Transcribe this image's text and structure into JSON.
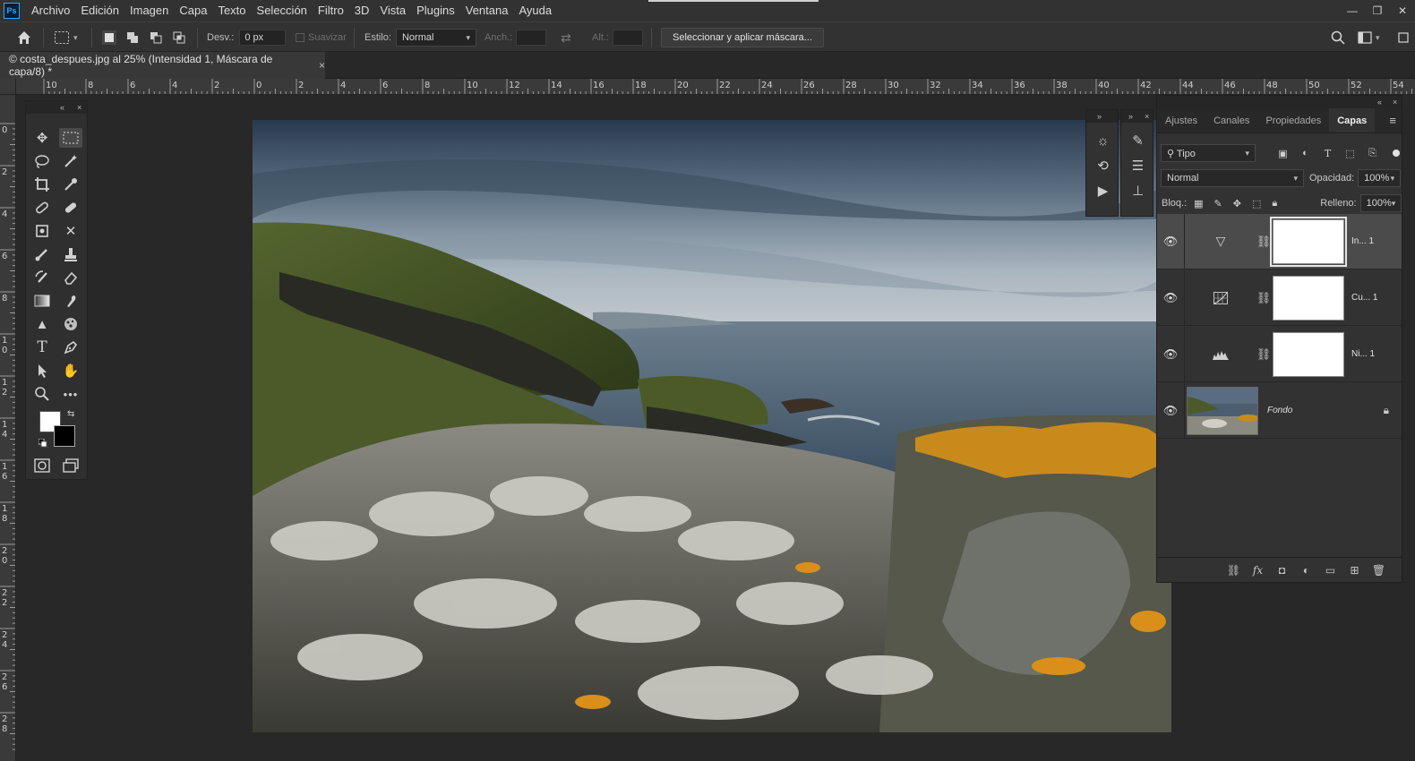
{
  "app": {
    "logo_text": "Ps"
  },
  "menu": [
    "Archivo",
    "Edición",
    "Imagen",
    "Capa",
    "Texto",
    "Selección",
    "Filtro",
    "3D",
    "Vista",
    "Plugins",
    "Ventana",
    "Ayuda"
  ],
  "window_controls": {
    "minimize": "—",
    "restore": "❐",
    "close": "✕"
  },
  "options": {
    "feather_label": "Desv.:",
    "feather_value": "0 px",
    "antialias_label": "Suavizar",
    "style_label": "Estilo:",
    "style_value": "Normal",
    "width_label": "Anch.:",
    "height_label": "Alt.:",
    "select_mask_button": "Seleccionar y aplicar máscara..."
  },
  "document": {
    "tab_title": "© costa_despues.jpg al 25% (Intensidad 1, Máscara de capa/8) *",
    "close": "×"
  },
  "rulers": {
    "horizontal": [
      "10",
      "8",
      "6",
      "4",
      "2",
      "0",
      "2",
      "4",
      "6",
      "8",
      "10",
      "12",
      "14",
      "16",
      "18",
      "20",
      "22",
      "24",
      "26",
      "28",
      "30",
      "32",
      "34",
      "36",
      "38",
      "40",
      "42",
      "44",
      "46",
      "48",
      "50",
      "52",
      "54"
    ],
    "vertical": [
      "0",
      "2",
      "4",
      "6",
      "8",
      "10",
      "12",
      "14",
      "16",
      "18",
      "20",
      "22",
      "24",
      "26",
      "28"
    ]
  },
  "toolbox": {
    "collapse": "«",
    "close": "×",
    "colors": {
      "foreground": "#ffffff",
      "background": "#000000"
    }
  },
  "mini_panel": {
    "collapse": "»",
    "close": "×"
  },
  "layers_panel": {
    "collapse": "«",
    "close": "×",
    "tabs": [
      "Ajustes",
      "Canales",
      "Propiedades",
      "Capas"
    ],
    "active_tab": "Capas",
    "filter_type": "Tipo",
    "blend_mode": "Normal",
    "opacity_label": "Opacidad:",
    "opacity_value": "100%",
    "lock_label": "Bloq.:",
    "fill_label": "Relleno:",
    "fill_value": "100%",
    "layers": [
      {
        "name": "In... 1",
        "type": "invert-adjustment",
        "selected": true
      },
      {
        "name": "Cu... 1",
        "type": "curves-adjustment",
        "selected": false
      },
      {
        "name": "Ni... 1",
        "type": "levels-adjustment",
        "selected": false
      },
      {
        "name": "Fondo",
        "type": "background",
        "selected": false,
        "locked": true
      }
    ]
  }
}
